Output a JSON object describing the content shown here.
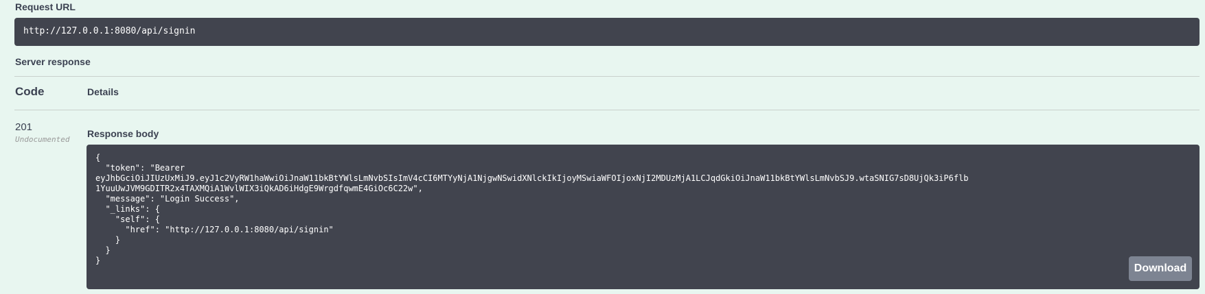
{
  "request_url": {
    "label": "Request URL",
    "value": "http://127.0.0.1:8080/api/signin"
  },
  "server_response": {
    "label": "Server response",
    "columns": {
      "code": "Code",
      "details": "Details"
    },
    "row": {
      "code": "201",
      "documentation_note": "Undocumented",
      "response_body_label": "Response body",
      "response_body": "{\n  \"token\": \"Bearer\neyJhbGciOiJIUzUxMiJ9.eyJ1c2VyRW1haWwiOiJnaW11bkBtYWlsLmNvbSIsImV4cCI6MTYyNjA1NjgwNSwidXNlckIkIjoyMSwiaWFOIjoxNjI2MDUzMjA1LCJqdGkiOiJnaW11bkBtYWlsLmNvbSJ9.wtaSNIG7sD8UjQk3iP6flb\n1YuuUwJVM9GDITR2x4TAXMQiA1WvlWIX3iQkAD6iHdgE9WrgdfqwmE4GiOc6C22w\",\n  \"message\": \"Login Success\",\n  \"_links\": {\n    \"self\": {\n      \"href\": \"http://127.0.0.1:8080/api/signin\"\n    }\n  }\n}",
      "download_label": "Download"
    }
  }
}
